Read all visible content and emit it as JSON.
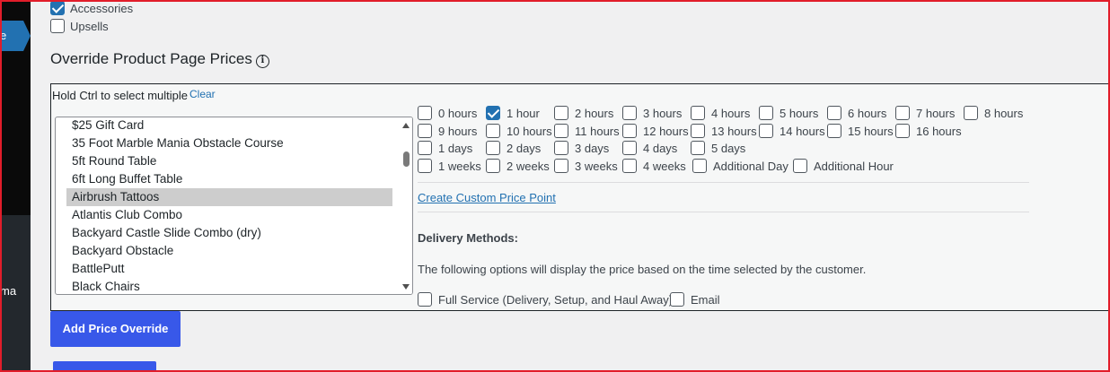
{
  "sidebar": {
    "active_fragment": "e",
    "item_fragment": "ma"
  },
  "product_types": [
    {
      "label": "Accessories",
      "checked": true
    },
    {
      "label": "Upsells",
      "checked": false
    }
  ],
  "override": {
    "title": "Override Product Page Prices",
    "hint": "Hold Ctrl to select multiple",
    "clear_label": "Clear",
    "products": [
      "$25 Gift Card",
      "35 Foot Marble Mania Obstacle Course",
      "5ft Round Table",
      "6ft Long Buffet Table",
      "Airbrush Tattoos",
      "Atlantis Club Combo",
      "Backyard Castle Slide Combo (dry)",
      "Backyard Obstacle",
      "BattlePutt",
      "Black Chairs"
    ],
    "selected_product": "Airbrush Tattoos",
    "price_points": [
      [
        {
          "label": "0 hours",
          "checked": false
        },
        {
          "label": "1 hour",
          "checked": true
        },
        {
          "label": "2 hours",
          "checked": false
        },
        {
          "label": "3 hours",
          "checked": false
        },
        {
          "label": "4 hours",
          "checked": false
        },
        {
          "label": "5 hours",
          "checked": false
        },
        {
          "label": "6 hours",
          "checked": false
        },
        {
          "label": "7 hours",
          "checked": false
        },
        {
          "label": "8 hours",
          "checked": false
        }
      ],
      [
        {
          "label": "9 hours",
          "checked": false
        },
        {
          "label": "10 hours",
          "checked": false
        },
        {
          "label": "11 hours",
          "checked": false
        },
        {
          "label": "12 hours",
          "checked": false
        },
        {
          "label": "13 hours",
          "checked": false
        },
        {
          "label": "14 hours",
          "checked": false
        },
        {
          "label": "15 hours",
          "checked": false
        },
        {
          "label": "16 hours",
          "checked": false
        }
      ],
      [
        {
          "label": "1 days",
          "checked": false
        },
        {
          "label": "2 days",
          "checked": false
        },
        {
          "label": "3 days",
          "checked": false
        },
        {
          "label": "4 days",
          "checked": false
        },
        {
          "label": "5 days",
          "checked": false
        }
      ],
      [
        {
          "label": "1 weeks",
          "checked": false
        },
        {
          "label": "2 weeks",
          "checked": false
        },
        {
          "label": "3 weeks",
          "checked": false
        },
        {
          "label": "4 weeks",
          "checked": false
        },
        {
          "label": "Additional Day",
          "checked": false
        },
        {
          "label": "Additional Hour",
          "checked": false
        }
      ]
    ],
    "custom_price_link": "Create Custom Price Point",
    "delivery_title": "Delivery Methods:",
    "delivery_desc": "The following options will display the price based on the time selected by the customer.",
    "delivery_methods": [
      {
        "label": "Full Service (Delivery, Setup, and Haul Away)",
        "checked": false
      },
      {
        "label": "Email",
        "checked": false
      }
    ]
  },
  "buttons": {
    "add_override": "Add Price Override"
  },
  "colors": {
    "accent": "#2271b1",
    "button": "#3858e9",
    "frame": "#e11d2a"
  }
}
